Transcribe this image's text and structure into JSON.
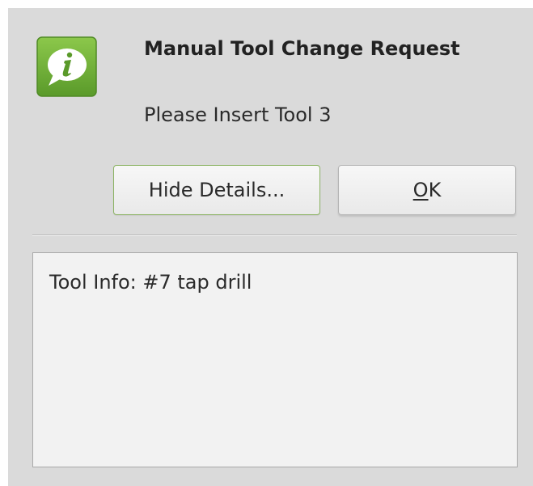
{
  "dialog": {
    "title": "Manual Tool Change Request",
    "message": "Please Insert Tool 3",
    "icon": "info-speech-bubble-icon",
    "accent_color": "#6fae3a"
  },
  "buttons": {
    "hide_details": "Hide Details...",
    "ok_mnemonic": "O",
    "ok_rest": "K"
  },
  "details": {
    "text": "Tool Info: #7 tap drill"
  }
}
